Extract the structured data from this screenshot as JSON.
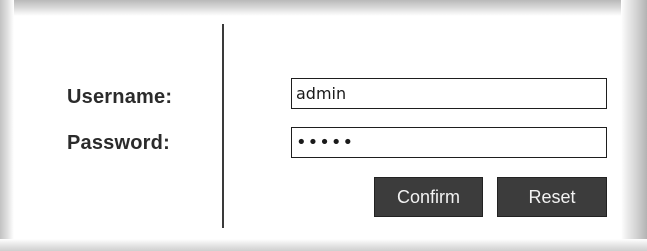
{
  "form": {
    "username_label": "Username:",
    "username_value": "admin",
    "password_label": "Password:",
    "password_value": "•••••",
    "confirm_label": "Confirm",
    "reset_label": "Reset"
  },
  "colors": {
    "text": "#2b2b2b",
    "button_bg": "#3c3c3c",
    "button_text": "#f2f2f2",
    "divider": "#3a3a3a",
    "field_border": "#1e1e1e"
  }
}
